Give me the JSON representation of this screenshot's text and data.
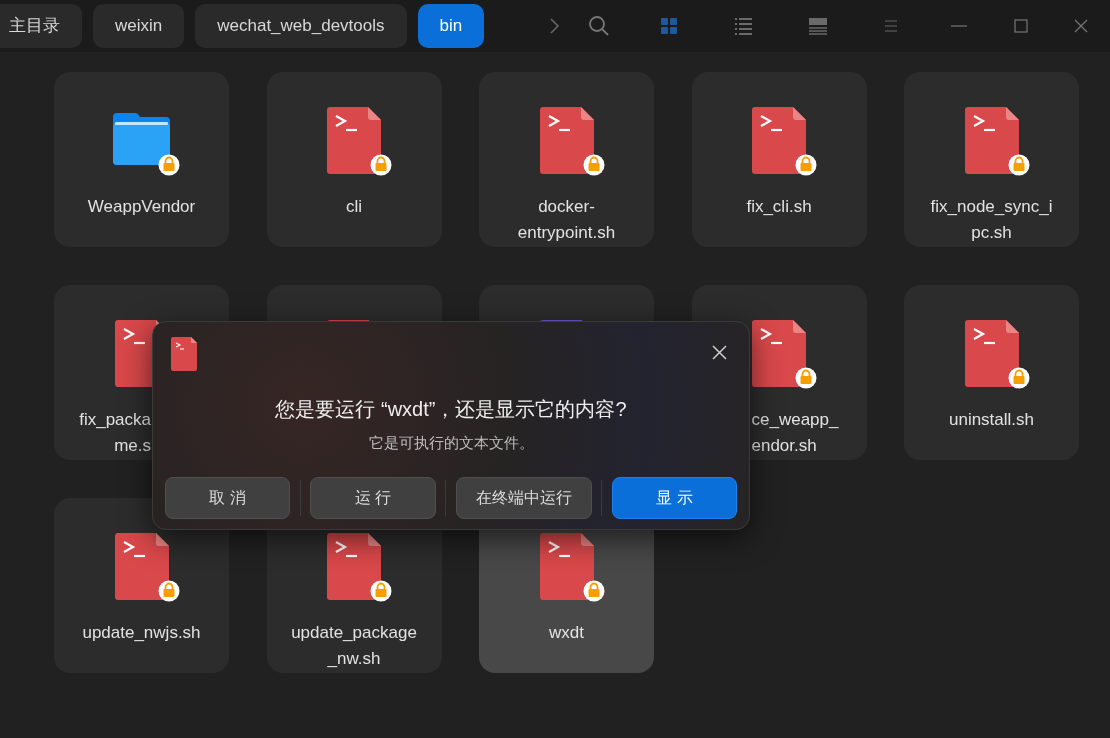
{
  "breadcrumbs": [
    {
      "label": "主目录",
      "selected": false
    },
    {
      "label": "weixin",
      "selected": false
    },
    {
      "label": "wechat_web_devtools",
      "selected": false
    },
    {
      "label": "bin",
      "selected": true
    }
  ],
  "view_modes": [
    {
      "kind": "icons",
      "selected": true
    },
    {
      "kind": "list",
      "selected": false
    },
    {
      "kind": "compact",
      "selected": false
    }
  ],
  "files": [
    {
      "kind": "folder",
      "label": [
        "WeappVendor"
      ],
      "locked": true,
      "selected": false
    },
    {
      "kind": "script",
      "label": [
        "cli"
      ],
      "locked": true,
      "selected": false
    },
    {
      "kind": "script",
      "label": [
        "docker-",
        "entrypoint.sh"
      ],
      "locked": true,
      "selected": false
    },
    {
      "kind": "script",
      "label": [
        "fix_cli.sh"
      ],
      "locked": true,
      "selected": false
    },
    {
      "kind": "script",
      "label": [
        "fix_node_sync_i",
        "pc.sh"
      ],
      "locked": true,
      "selected": false
    },
    {
      "kind": "script",
      "label": [
        "fix_packa",
        "me.s"
      ],
      "selected": false
    },
    {
      "kind": "script",
      "selected": false
    },
    {
      "kind": "document",
      "selected": false
    },
    {
      "kind": "script",
      "label": [
        "ce_weapp_",
        "endor.sh"
      ],
      "locked": true,
      "selected": false
    },
    {
      "kind": "script",
      "label": [
        "uninstall.sh"
      ],
      "locked": true,
      "selected": false
    },
    {
      "kind": "script",
      "label": [
        "update_nwjs.sh"
      ],
      "locked": true,
      "selected": false
    },
    {
      "kind": "script",
      "label": [
        "update_package",
        "_nw.sh"
      ],
      "locked": true,
      "selected": false
    },
    {
      "kind": "script",
      "label": [
        "wxdt"
      ],
      "locked": true,
      "selected": true
    }
  ],
  "dialog": {
    "title": "您是要运行 “wxdt”，还是显示它的内容?",
    "message": "它是可执行的文本文件。",
    "buttons": [
      {
        "label": "取 消",
        "primary": false
      },
      {
        "label": "运 行",
        "primary": false
      },
      {
        "label": "在终端中运行",
        "primary": false
      },
      {
        "label": "显 示",
        "primary": true
      }
    ]
  }
}
